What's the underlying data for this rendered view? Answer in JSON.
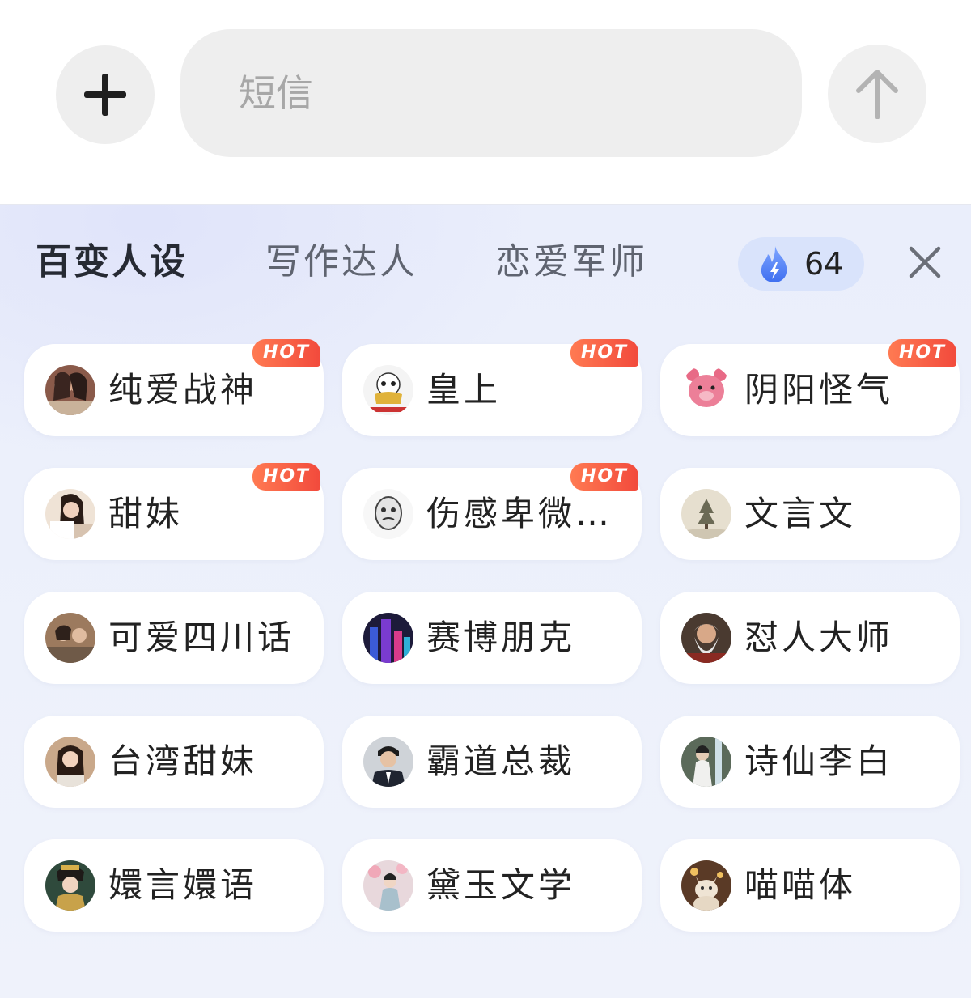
{
  "composer": {
    "placeholder": "短信",
    "add_icon": "plus-icon",
    "send_icon": "arrow-up-icon"
  },
  "tabs": [
    {
      "label": "百变人设",
      "active": true
    },
    {
      "label": "写作达人",
      "active": false
    },
    {
      "label": "恋爱军师",
      "active": false
    }
  ],
  "energy": {
    "count": "64",
    "icon": "flame-icon",
    "color": "#5b8cf5"
  },
  "hot_badge": "HOT",
  "accent": {
    "hot_start": "#ff7a52",
    "hot_end": "#f24a3c"
  },
  "personas": [
    {
      "label": "纯爱战神",
      "hot": true
    },
    {
      "label": "皇上",
      "hot": true
    },
    {
      "label": "阴阳怪气",
      "hot": true
    },
    {
      "label": "甜妹",
      "hot": true
    },
    {
      "label": "伤感卑微…",
      "hot": true
    },
    {
      "label": "文言文",
      "hot": false
    },
    {
      "label": "可爱四川话",
      "hot": false
    },
    {
      "label": "赛博朋克",
      "hot": false
    },
    {
      "label": "怼人大师",
      "hot": false
    },
    {
      "label": "台湾甜妹",
      "hot": false
    },
    {
      "label": "霸道总裁",
      "hot": false
    },
    {
      "label": "诗仙李白",
      "hot": false
    },
    {
      "label": "嬛言嬛语",
      "hot": false
    },
    {
      "label": "黛玉文学",
      "hot": false
    },
    {
      "label": "喵喵体",
      "hot": false
    }
  ]
}
